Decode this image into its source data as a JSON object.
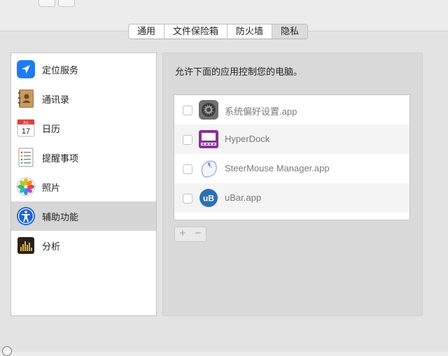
{
  "tabs": [
    {
      "label": "通用",
      "selected": false
    },
    {
      "label": "文件保险箱",
      "selected": false
    },
    {
      "label": "防火墙",
      "selected": false
    },
    {
      "label": "隐私",
      "selected": true
    }
  ],
  "sidebar": {
    "items": [
      {
        "label": "定位服务",
        "icon": "location-arrow-icon",
        "selected": false
      },
      {
        "label": "通讯录",
        "icon": "contacts-book-icon",
        "selected": false
      },
      {
        "label": "日历",
        "icon": "calendar-icon",
        "selected": false
      },
      {
        "label": "提醒事项",
        "icon": "reminders-list-icon",
        "selected": false
      },
      {
        "label": "照片",
        "icon": "photos-flower-icon",
        "selected": false
      },
      {
        "label": "辅助功能",
        "icon": "accessibility-icon",
        "selected": true
      },
      {
        "label": "分析",
        "icon": "analytics-icon",
        "selected": false
      }
    ],
    "calendar_month": "JUL",
    "calendar_day": "17"
  },
  "main": {
    "allow_label": "允许下面的应用控制您的电脑。",
    "apps": [
      {
        "label": "系统偏好设置.app",
        "icon": "system-preferences-gear-icon",
        "checked": false
      },
      {
        "label": "HyperDock",
        "icon": "hyperdock-icon",
        "checked": false
      },
      {
        "label": "SteerMouse Manager.app",
        "icon": "mouse-icon",
        "checked": false
      },
      {
        "label": "uBar.app",
        "icon": "ubar-icon",
        "checked": false
      }
    ],
    "ubar_icon_text": "uB",
    "plus_label": "+",
    "minus_label": "−"
  },
  "colors": {
    "selected_row": "#d6d6d6",
    "location_blue": "#1e7bf2",
    "hyperdock_purple": "#8a2f9a",
    "ubar_blue": "#2d6fb5"
  }
}
